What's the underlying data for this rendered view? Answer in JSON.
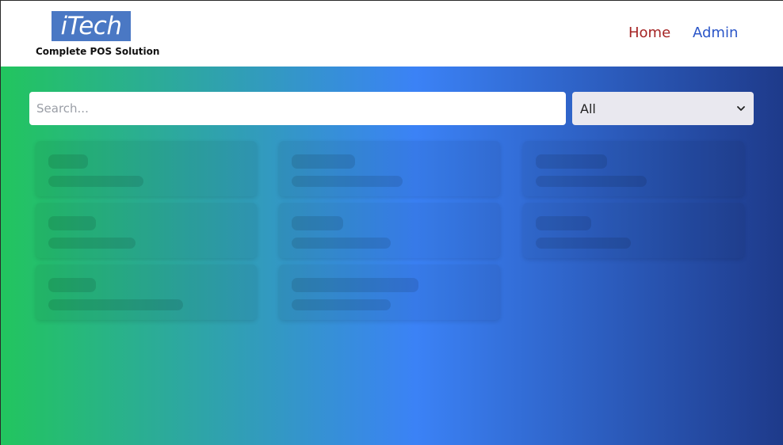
{
  "header": {
    "logo_text": "iTech",
    "tagline": "Complete POS Solution",
    "nav": {
      "home": "Home",
      "admin": "Admin"
    }
  },
  "toolbar": {
    "search_placeholder": "Search...",
    "search_value": "",
    "filter_selected": "All"
  },
  "colors": {
    "gradient_start": "#22c55e",
    "gradient_mid": "#3b82f6",
    "gradient_end": "#1e3a8a",
    "nav_home": "#a52424",
    "nav_admin": "#2b56c8",
    "logo_bg": "#4a78c4"
  },
  "icons": {
    "select_chevron": "chevron-down-icon"
  },
  "content": {
    "state": "loading-skeleton"
  }
}
